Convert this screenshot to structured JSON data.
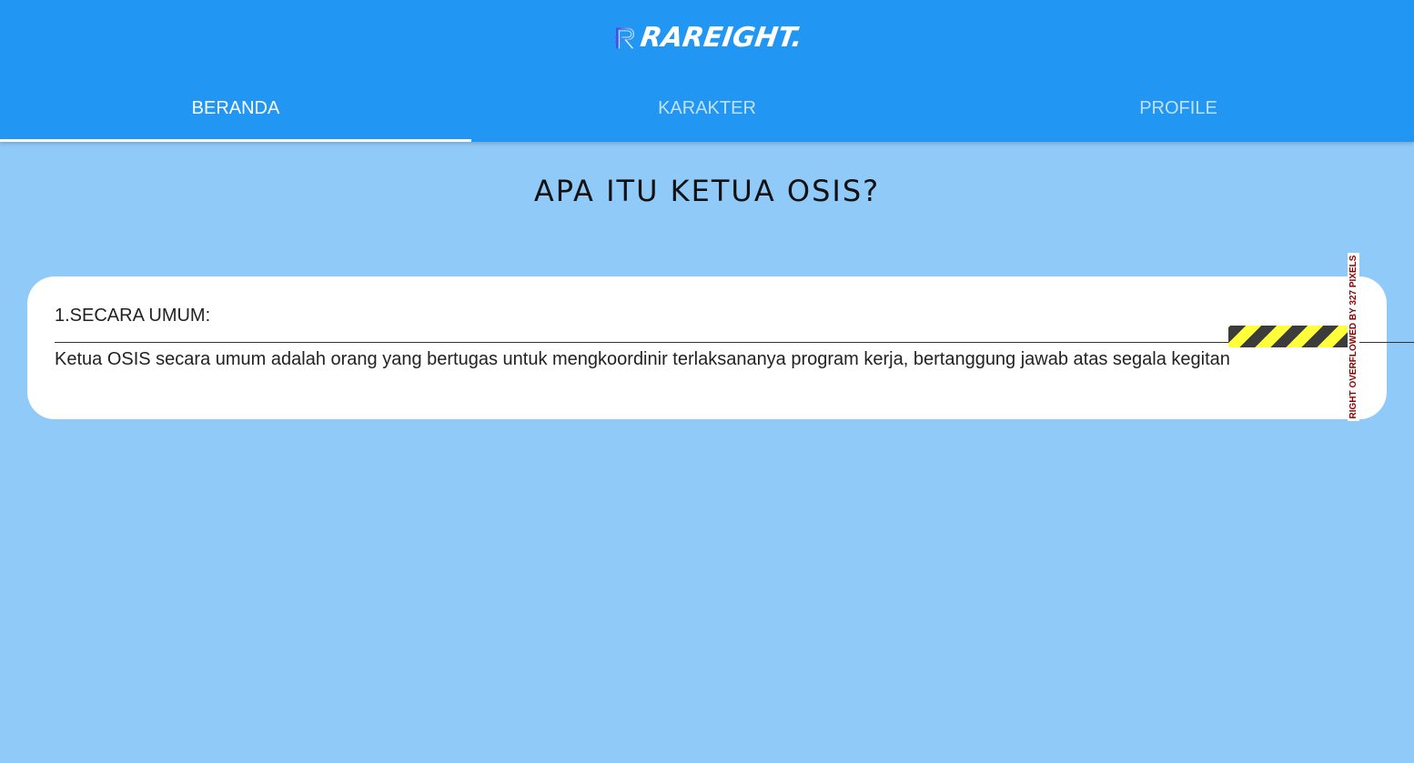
{
  "appbar": {
    "logo_text": "RAREIGHT.",
    "colors": {
      "appbar": "#2196F3",
      "background": "#90CAF9",
      "card": "#FFFFFF",
      "indicator": "#FFFFFF"
    }
  },
  "tabs": [
    {
      "label": "BERANDA",
      "active": true
    },
    {
      "label": "KARAKTER",
      "active": false
    },
    {
      "label": "PROFILE",
      "active": false
    }
  ],
  "main": {
    "heading": "APA ITU KETUA OSIS?",
    "card": {
      "section_title": "1.SECARA UMUM:",
      "body": "Ketua OSIS secara umum adalah orang yang bertugas untuk mengkoordinir terlaksananya program kerja, bertanggung jawab atas segala kegitan"
    }
  },
  "debug": {
    "overflow_message": "RIGHT OVERFLOWED BY 327 PIXELS",
    "stripe_colors": [
      "#3C3C3C",
      "#FFFF3A"
    ]
  }
}
